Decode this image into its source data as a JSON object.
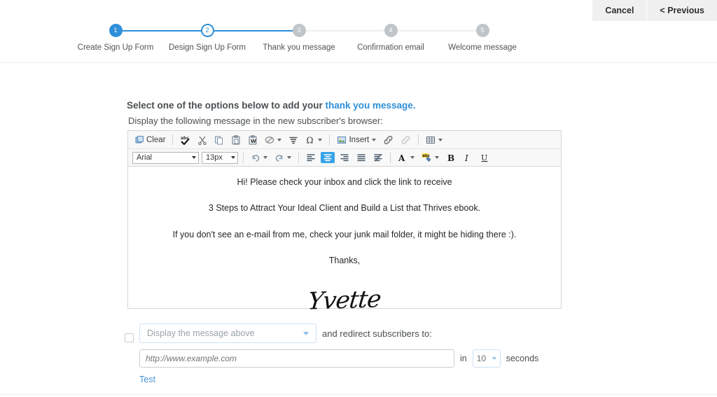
{
  "header": {
    "buttons": [
      {
        "label": "Cancel",
        "name": "cancel-button"
      },
      {
        "label": "< Previous",
        "name": "previous-button"
      }
    ]
  },
  "stepper": {
    "steps": [
      {
        "number": "1",
        "label": "Create Sign Up Form",
        "state": "done"
      },
      {
        "number": "2",
        "label": "Design Sign Up Form",
        "state": "current"
      },
      {
        "number": "3",
        "label": "Thank you message",
        "state": "todo"
      },
      {
        "number": "4",
        "label": "Confirmation email",
        "state": "todo"
      },
      {
        "number": "5",
        "label": "Welcome message",
        "state": "todo"
      }
    ],
    "active_color": "#2f8fd8",
    "inactive_color": "#bfc5c9"
  },
  "main": {
    "intro_prefix": "Select one of the options below to add your ",
    "intro_link": "thank you message.",
    "subintro": "Display the following message in the new subscriber's browser:"
  },
  "editor": {
    "toolbar_row1": [
      {
        "name": "clear-button",
        "label": "Clear",
        "icon": "clear-icon",
        "caret": false
      },
      {
        "name": "spellcheck-button",
        "label": "",
        "icon": "spellcheck-icon",
        "caret": false
      },
      {
        "name": "cut-button",
        "label": "",
        "icon": "scissors-icon",
        "caret": false
      },
      {
        "name": "copy-button",
        "label": "",
        "icon": "copy-icon",
        "caret": false
      },
      {
        "name": "paste-button",
        "label": "",
        "icon": "paste-icon",
        "caret": false
      },
      {
        "name": "paste-from-word-button",
        "label": "",
        "icon": "paste-word-icon",
        "caret": false
      },
      {
        "name": "remove-format-button",
        "label": "",
        "icon": "eraser-icon",
        "caret": true
      },
      {
        "name": "line-height-button",
        "label": "",
        "icon": "lines-icon",
        "caret": false
      },
      {
        "name": "special-character-button",
        "label": "",
        "icon": "omega-icon",
        "caret": true
      },
      {
        "name": "insert-image-button",
        "label": "Insert",
        "icon": "image-icon",
        "caret": true
      },
      {
        "name": "insert-link-button",
        "label": "",
        "icon": "link-icon",
        "caret": false
      },
      {
        "name": "unlink-button",
        "label": "",
        "icon": "unlink-icon",
        "caret": false
      },
      {
        "name": "insert-table-button",
        "label": "",
        "icon": "table-icon",
        "caret": true
      }
    ],
    "font_family": "Arial",
    "font_size": "13px",
    "toolbar_row2": [
      {
        "name": "undo-button",
        "icon": "undo-icon",
        "caret": true
      },
      {
        "name": "redo-button",
        "icon": "redo-icon",
        "caret": true
      },
      {
        "name": "align-left-button",
        "icon": "align-left-icon",
        "active": false
      },
      {
        "name": "align-center-button",
        "icon": "align-center-icon",
        "active": true
      },
      {
        "name": "align-right-button",
        "icon": "align-right-icon",
        "active": false
      },
      {
        "name": "align-justify-button",
        "icon": "align-justify-icon",
        "active": false
      },
      {
        "name": "remove-align-button",
        "icon": "remove-align-icon",
        "active": false
      },
      {
        "name": "text-color-button",
        "icon": "text-color-icon",
        "caret": true
      },
      {
        "name": "highlight-color-button",
        "icon": "highlight-icon",
        "caret": true
      },
      {
        "name": "bold-button",
        "icon": "bold-icon",
        "active": false
      },
      {
        "name": "italic-button",
        "icon": "italic-icon",
        "active": false
      },
      {
        "name": "underline-button",
        "icon": "underline-icon",
        "active": false
      }
    ],
    "content": {
      "line1": "Hi! Please check your inbox and click the link to receive",
      "line2": "3 Steps to Attract Your Ideal Client and Build a List that Thrives ebook.",
      "line3": "If you don't see an e-mail from me, check your junk mail folder, it might be hiding there :).",
      "line4": "Thanks,",
      "signature": "Yvette"
    }
  },
  "options": {
    "display_select_value": "Display the message above",
    "redirect_label": "and redirect subscribers to:",
    "url_placeholder": "http://www.example.com",
    "in_label": "in",
    "seconds_value": "10",
    "seconds_label": "seconds",
    "test_link": "Test"
  }
}
